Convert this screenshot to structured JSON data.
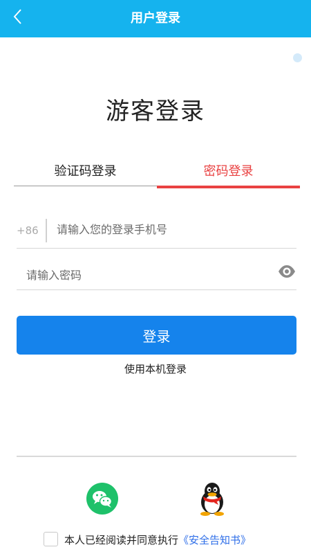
{
  "header": {
    "title": "用户登录",
    "back_icon": "chevron-left-icon"
  },
  "page": {
    "title": "游客登录"
  },
  "tabs": [
    {
      "label": "验证码登录",
      "active": false
    },
    {
      "label": "密码登录",
      "active": true
    }
  ],
  "phone": {
    "country_code": "+86",
    "placeholder": "请输入您的登录手机号",
    "value": ""
  },
  "password": {
    "placeholder": "请输入密码",
    "value": "",
    "toggle_icon": "eye-icon"
  },
  "login_button": {
    "label": "登录"
  },
  "local_login": {
    "label": "使用本机登录"
  },
  "third_party": [
    {
      "name": "wechat",
      "icon": "wechat-icon"
    },
    {
      "name": "qq",
      "icon": "qq-icon"
    }
  ],
  "agreement": {
    "checked": false,
    "text": "本人已经阅读并同意执行",
    "link": "《安全告知书》"
  },
  "colors": {
    "header": "#15b3ee",
    "accent": "#1583ec",
    "active_tab": "#e94141",
    "link": "#2e6ee8",
    "wechat": "#1ec16a"
  }
}
